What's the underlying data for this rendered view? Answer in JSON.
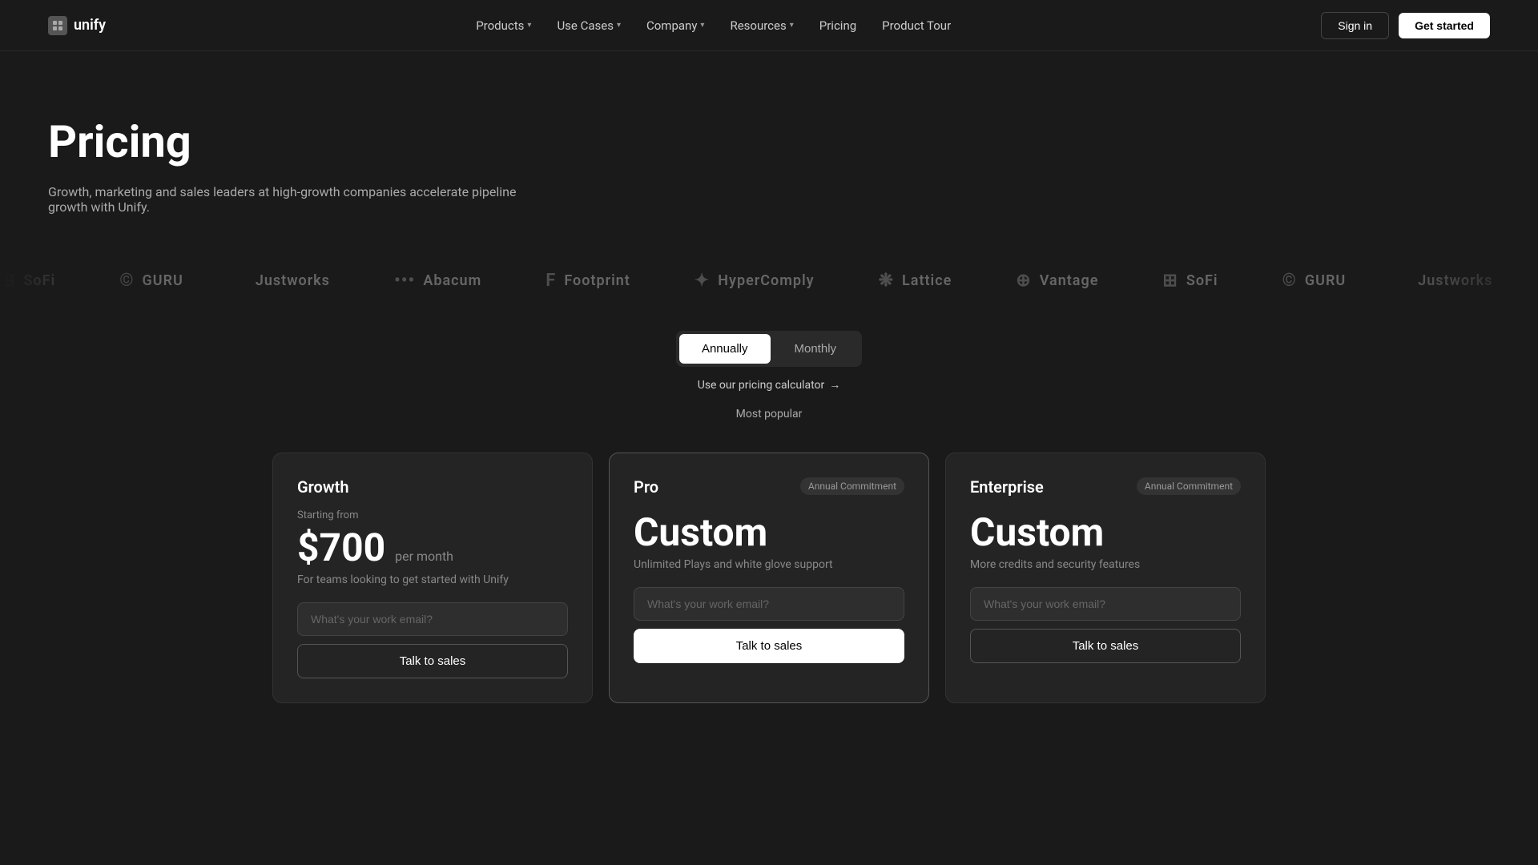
{
  "nav": {
    "logo_text": "unify",
    "links": [
      {
        "label": "Products",
        "has_dropdown": true
      },
      {
        "label": "Use Cases",
        "has_dropdown": true
      },
      {
        "label": "Company",
        "has_dropdown": true
      },
      {
        "label": "Resources",
        "has_dropdown": true
      },
      {
        "label": "Pricing",
        "has_dropdown": false
      },
      {
        "label": "Product Tour",
        "has_dropdown": false
      }
    ],
    "signin_label": "Sign in",
    "getstarted_label": "Get started"
  },
  "hero": {
    "title": "Pricing",
    "subtitle": "Growth, marketing and sales leaders at high-growth companies accelerate pipeline growth with Unify."
  },
  "logos": [
    {
      "name": "SoFi",
      "symbol": "⊞"
    },
    {
      "name": "GURU",
      "symbol": "©"
    },
    {
      "name": "Justworks",
      "symbol": ""
    },
    {
      "name": "Abacum",
      "symbol": "•••"
    },
    {
      "name": "Footprint",
      "symbol": "F"
    },
    {
      "name": "HyperComply",
      "symbol": "✦"
    },
    {
      "name": "Lattice",
      "symbol": "❋"
    },
    {
      "name": "Vantage",
      "symbol": "⊕"
    }
  ],
  "pricing_toggle": {
    "annually_label": "Annually",
    "monthly_label": "Monthly",
    "active": "annually",
    "calc_link": "Use our pricing calculator",
    "most_popular": "Most popular"
  },
  "cards": [
    {
      "id": "growth",
      "title": "Growth",
      "badge": null,
      "starting_from": "Starting from",
      "price": "$700",
      "per": "per month",
      "description": "For teams looking to get started with Unify",
      "input_placeholder": "What's your work email?",
      "btn_label": "Talk to sales",
      "btn_type": "secondary",
      "featured": false
    },
    {
      "id": "pro",
      "title": "Pro",
      "badge": "Annual Commitment",
      "starting_from": null,
      "price": "Custom",
      "per": null,
      "description": "Unlimited Plays and white glove support",
      "input_placeholder": "What's your work email?",
      "btn_label": "Talk to sales",
      "btn_type": "primary",
      "featured": true
    },
    {
      "id": "enterprise",
      "title": "Enterprise",
      "badge": "Annual Commitment",
      "starting_from": null,
      "price": "Custom",
      "per": null,
      "description": "More credits and security features",
      "input_placeholder": "What's your work email?",
      "btn_label": "Talk to sales",
      "btn_type": "secondary",
      "featured": false
    }
  ]
}
